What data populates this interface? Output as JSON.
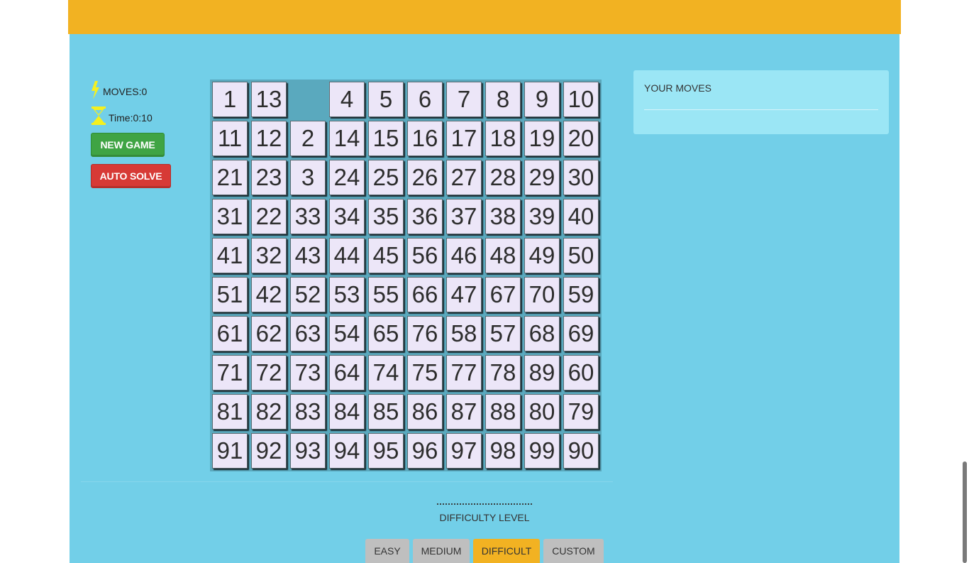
{
  "stats": {
    "moves_label": "MOVES:0",
    "time_label": "Time:0:10",
    "moves_icon": "lightning-icon",
    "time_icon": "hourglass-icon",
    "icon_color": "#f5f01e"
  },
  "buttons": {
    "new_game": "NEW GAME",
    "auto_solve": "AUTO SOLVE"
  },
  "board": {
    "size": 10,
    "tiles": [
      [
        1,
        13,
        null,
        4,
        5,
        6,
        7,
        8,
        9,
        10
      ],
      [
        11,
        12,
        2,
        14,
        15,
        16,
        17,
        18,
        19,
        20
      ],
      [
        21,
        23,
        3,
        24,
        25,
        26,
        27,
        28,
        29,
        30
      ],
      [
        31,
        22,
        33,
        34,
        35,
        36,
        37,
        38,
        39,
        40
      ],
      [
        41,
        32,
        43,
        44,
        45,
        56,
        46,
        48,
        49,
        50
      ],
      [
        51,
        42,
        52,
        53,
        55,
        66,
        47,
        67,
        70,
        59
      ],
      [
        61,
        62,
        63,
        54,
        65,
        76,
        58,
        57,
        68,
        69
      ],
      [
        71,
        72,
        73,
        64,
        74,
        75,
        77,
        78,
        89,
        60
      ],
      [
        81,
        82,
        83,
        84,
        85,
        86,
        87,
        88,
        80,
        79
      ],
      [
        91,
        92,
        93,
        94,
        95,
        96,
        97,
        98,
        99,
        90
      ]
    ]
  },
  "moves_panel": {
    "title": "YOUR MOVES"
  },
  "difficulty": {
    "label": "DIFFICULTY LEVEL",
    "levels": [
      "EASY",
      "MEDIUM",
      "DIFFICULT",
      "CUSTOM"
    ],
    "selected": "DIFFICULT"
  },
  "colors": {
    "header": "#f2b222",
    "background": "#72cfe8",
    "tile": "#ece6f8",
    "new_game": "#3fa444",
    "auto_solve": "#d73a36",
    "active_level": "#f2b222"
  }
}
